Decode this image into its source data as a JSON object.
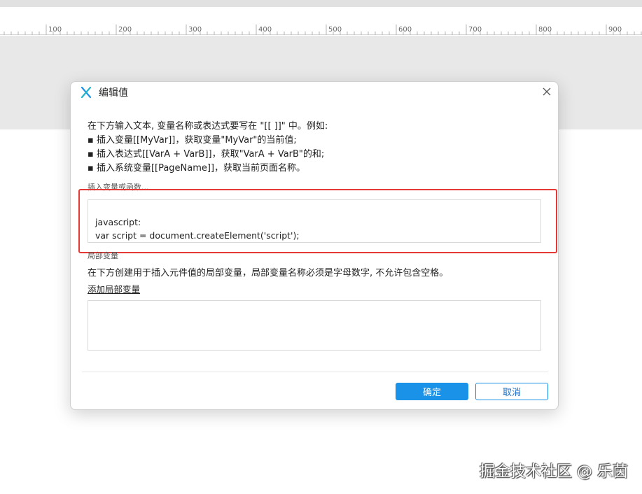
{
  "ruler": {
    "ticks": [
      "100",
      "200",
      "300",
      "400",
      "500",
      "600",
      "700",
      "800",
      "900"
    ]
  },
  "dialog": {
    "title": "编辑值",
    "intro_lines": [
      "在下方输入文本, 变量名称或表达式要写在 \"[[ ]]\" 中。例如:",
      "▪ 插入变量[[MyVar]]，获取变量\"MyVar\"的当前值;",
      "▪ 插入表达式[[VarA + VarB]]，获取\"VarA + VarB\"的和;",
      "▪ 插入系统变量[[PageName]]，获取当前页面名称。"
    ],
    "insert_label": "插入变量或函数...",
    "text_lines": [
      "javascript:",
      "var script = document.createElement('script');"
    ],
    "local_vars_label": "局部变量",
    "local_vars_desc": "在下方创建用于插入元件值的局部变量，局部变量名称必须是字母数字, 不允许包含空格。",
    "add_local_var": "添加局部变量",
    "ok": "确定",
    "cancel": "取消"
  },
  "watermark": "掘金技术社区 @ 乐茵",
  "colors": {
    "accent": "#1a92e8",
    "highlight": "#e53935",
    "logo": "#1a92e8"
  },
  "icons": {
    "logo": "axure-logo-icon",
    "close": "close-icon"
  }
}
